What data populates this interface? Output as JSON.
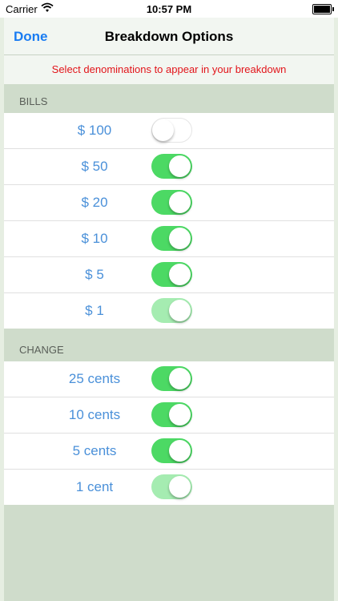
{
  "status_bar": {
    "carrier": "Carrier",
    "time": "10:57 PM",
    "wifi_icon": "wifi-icon",
    "battery_icon": "battery-icon"
  },
  "nav": {
    "done_label": "Done",
    "title": "Breakdown Options"
  },
  "instruction": "Select denominations to appear in your breakdown",
  "sections": [
    {
      "header": "BILLS",
      "rows": [
        {
          "label": "$ 100",
          "enabled": false,
          "faded": false
        },
        {
          "label": "$ 50",
          "enabled": true,
          "faded": false
        },
        {
          "label": "$ 20",
          "enabled": true,
          "faded": false
        },
        {
          "label": "$ 10",
          "enabled": true,
          "faded": false
        },
        {
          "label": "$ 5",
          "enabled": true,
          "faded": false
        },
        {
          "label": "$ 1",
          "enabled": true,
          "faded": true
        }
      ]
    },
    {
      "header": "CHANGE",
      "rows": [
        {
          "label": "25 cents",
          "enabled": true,
          "faded": false
        },
        {
          "label": "10 cents",
          "enabled": true,
          "faded": false
        },
        {
          "label": "5 cents",
          "enabled": true,
          "faded": false
        },
        {
          "label": "1 cent",
          "enabled": true,
          "faded": true
        }
      ]
    }
  ],
  "colors": {
    "toggle_on": "#4cd964",
    "toggle_on_faded": "#a5ecb1",
    "label_blue": "#4a90d9",
    "instruction_red": "#e2141a",
    "done_blue": "#1a7cf2"
  }
}
